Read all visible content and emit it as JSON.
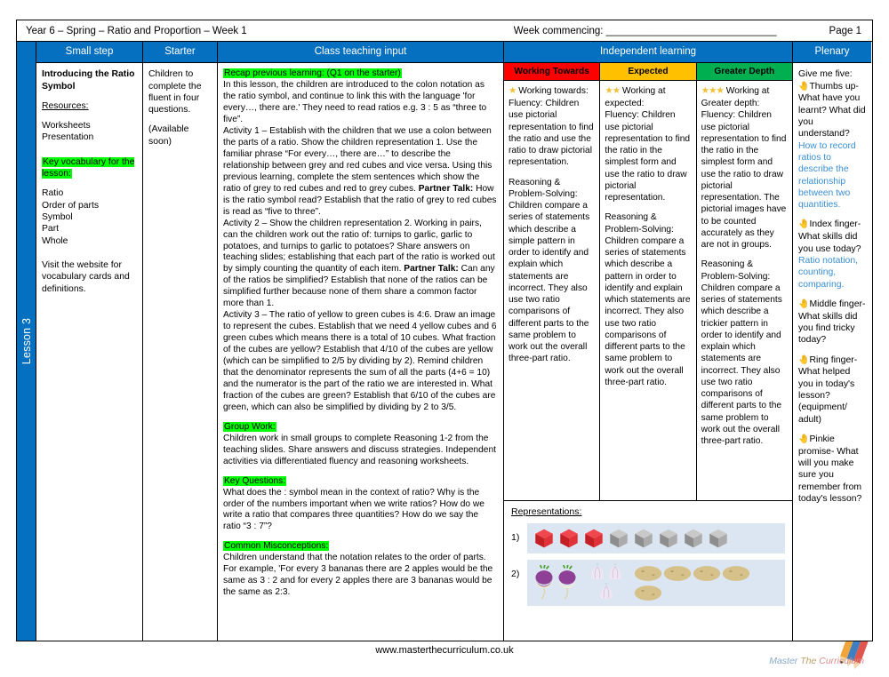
{
  "header": {
    "title": "Year 6 – Spring – Ratio and Proportion – Week 1",
    "week_commencing": "Week commencing: ______________________________",
    "page": "Page 1"
  },
  "spine": {
    "label": "Lesson 3"
  },
  "columns": {
    "small_step": "Small step",
    "starter": "Starter",
    "class_teaching_input": "Class teaching input",
    "independent_learning": "Independent learning",
    "plenary": "Plenary"
  },
  "small_step": {
    "lesson_title": "Introducing the Ratio Symbol",
    "resources_heading": "Resources:",
    "resources": [
      "Worksheets",
      "Presentation"
    ],
    "vocab_heading": "Key vocabulary for the lesson:",
    "vocab": [
      "Ratio",
      "Order of parts",
      "Symbol",
      "Part",
      "Whole"
    ],
    "website_note": "Visit the website for vocabulary cards and definitions."
  },
  "starter": {
    "text": "Children to complete the fluent in four questions.",
    "availability": "(Available soon)"
  },
  "teaching": {
    "recap_heading": "Recap previous learning: (Q1 on the starter)",
    "recap_body": "In this lesson, the children are introduced to the colon notation as the ratio symbol, and continue to link this with the language 'for every…, there are.' They need to read ratios e.g. 3 : 5 as “three to five”.",
    "activity1": "Activity 1 – Establish with the children that we use a colon between the parts of a ratio. Show the children representation 1. Use the familiar phrase “For every…, there are…” to describe the relationship between grey and red cubes and vice versa. Using this previous learning, complete the stem sentences which show the ratio of grey to red cubes and red to grey cubes. ",
    "activity1_talk_label": "Partner Talk:",
    "activity1_talk": " How is the ratio symbol read? Establish that the ratio of grey to red cubes is read as “five to three”.",
    "activity2": "Activity 2 – Show the children representation 2. Working in pairs, can the children work out the ratio of: turnips to garlic, garlic to potatoes, and turnips to garlic to potatoes? Share answers on teaching slides; establishing that each part of the ratio is worked out by simply counting the quantity of each item. ",
    "activity2_talk_label": "Partner Talk:",
    "activity2_talk": " Can any of the ratios be simplified? Establish that none of the ratios can be simplified further because none of them share a common factor more than 1.",
    "activity3": "Activity 3 – The ratio of yellow to green cubes is 4:6. Draw an image to represent the cubes. Establish that we need 4 yellow cubes and 6 green cubes which means there is a total of 10 cubes. What fraction of the cubes are yellow? Establish that 4/10 of the cubes are yellow (which can be simplified to 2/5 by dividing by 2). Remind children that the denominator represents the sum of all the parts (4+6 = 10) and the numerator is the part of the ratio we are interested in. What fraction of the cubes are green? Establish that 6/10 of the cubes are green, which can also be simplified by dividing by 2 to 3/5.",
    "group_work_heading": "Group Work:",
    "group_work_body": "Children work in small groups to complete Reasoning 1-2 from the teaching slides. Share answers and discuss strategies. Independent activities via differentiated fluency and reasoning worksheets.",
    "key_questions_heading": "Key Questions:",
    "key_questions_body": "What does the : symbol mean in the context of ratio? Why is the order of the numbers important when we write ratios? How do we write a ratio that compares three quantities? How do we say the ratio “3 : 7”?",
    "misconceptions_heading": "Common Misconceptions:",
    "misconceptions_body": "Children understand that the notation relates to the order of parts. For example, 'For every 3 bananas there are 2 apples would be the same as 3 : 2 and for every 2 apples there are 3 bananas would be the same as 2:3."
  },
  "independent": {
    "levels": [
      {
        "header": "Working Towards",
        "header_color": "#ff0000",
        "stars": 1,
        "intro": "Working towards:",
        "fluency": "Fluency: Children use pictorial representation to find the ratio and use the ratio to draw pictorial representation.",
        "reasoning": "Reasoning & Problem-Solving: Children compare a series of statements which describe a simple pattern in order to identify and explain which statements are incorrect. They also use two ratio comparisons of different parts to the same problem to work out the overall three-part ratio."
      },
      {
        "header": "Expected",
        "header_color": "#ffc000",
        "stars": 2,
        "intro": "Working at expected:",
        "fluency": "Fluency: Children use pictorial representation to find the ratio in the simplest form and use the ratio to draw pictorial representation.",
        "reasoning": "Reasoning & Problem-Solving: Children compare a series of statements which describe a pattern in order to identify and explain which statements are incorrect. They also use two ratio comparisons of different parts to the same problem to work out the overall three-part ratio."
      },
      {
        "header": "Greater Depth",
        "header_color": "#00b050",
        "stars": 3,
        "intro": "Working at Greater depth:",
        "fluency": "Fluency: Children use pictorial representation to find the ratio in the simplest form and use the ratio to draw pictorial representation. The pictorial images have to be counted accurately as they are not in groups.",
        "reasoning": "Reasoning & Problem-Solving: Children compare a series of statements which describe a trickier pattern in order to identify and explain which statements are incorrect. They also use two ratio comparisons of different parts to the same problem to work out the overall three-part ratio."
      }
    ],
    "representations_heading": "Representations:",
    "representations": [
      {
        "number": "1)",
        "items": [
          {
            "type": "cube",
            "color": "#e8262b",
            "count": 3
          },
          {
            "type": "cube",
            "color": "#9b9b9b",
            "count": 5
          }
        ]
      },
      {
        "number": "2)",
        "items": [
          {
            "type": "turnip",
            "count": 2
          },
          {
            "type": "garlic",
            "count": 3
          },
          {
            "type": "potato",
            "count": 5
          }
        ]
      }
    ]
  },
  "plenary": {
    "intro": "Give me five:",
    "items": [
      {
        "icon": "hand-thumbs-up",
        "prompt": "Thumbs up- What have you learnt? What did you understand?",
        "answer": "How to record ratios to describe the relationship between two quantities."
      },
      {
        "icon": "hand-index-finger",
        "prompt": "Index finger- What skills did you use today?",
        "answer": "Ratio notation, counting, comparing."
      },
      {
        "icon": "hand-middle-finger",
        "prompt": "Middle finger- What skills did you find tricky today?",
        "answer": ""
      },
      {
        "icon": "hand-ring-finger",
        "prompt": "Ring finger- What helped you in today's lesson? (equipment/ adult)",
        "answer": ""
      },
      {
        "icon": "hand-pinkie",
        "prompt": "Pinkie promise- What will you make sure you remember from today's lesson?",
        "answer": ""
      }
    ]
  },
  "footer": {
    "url": "www.masterthecurriculum.co.uk",
    "logo_word1": "Master",
    "logo_word2": "The",
    "logo_word3": "Curriculum"
  },
  "colors": {
    "header_blue": "#0670C0",
    "highlight_green": "#00ff00",
    "link_blue": "#3a8fd4",
    "panel_blue": "#dce6f2"
  }
}
